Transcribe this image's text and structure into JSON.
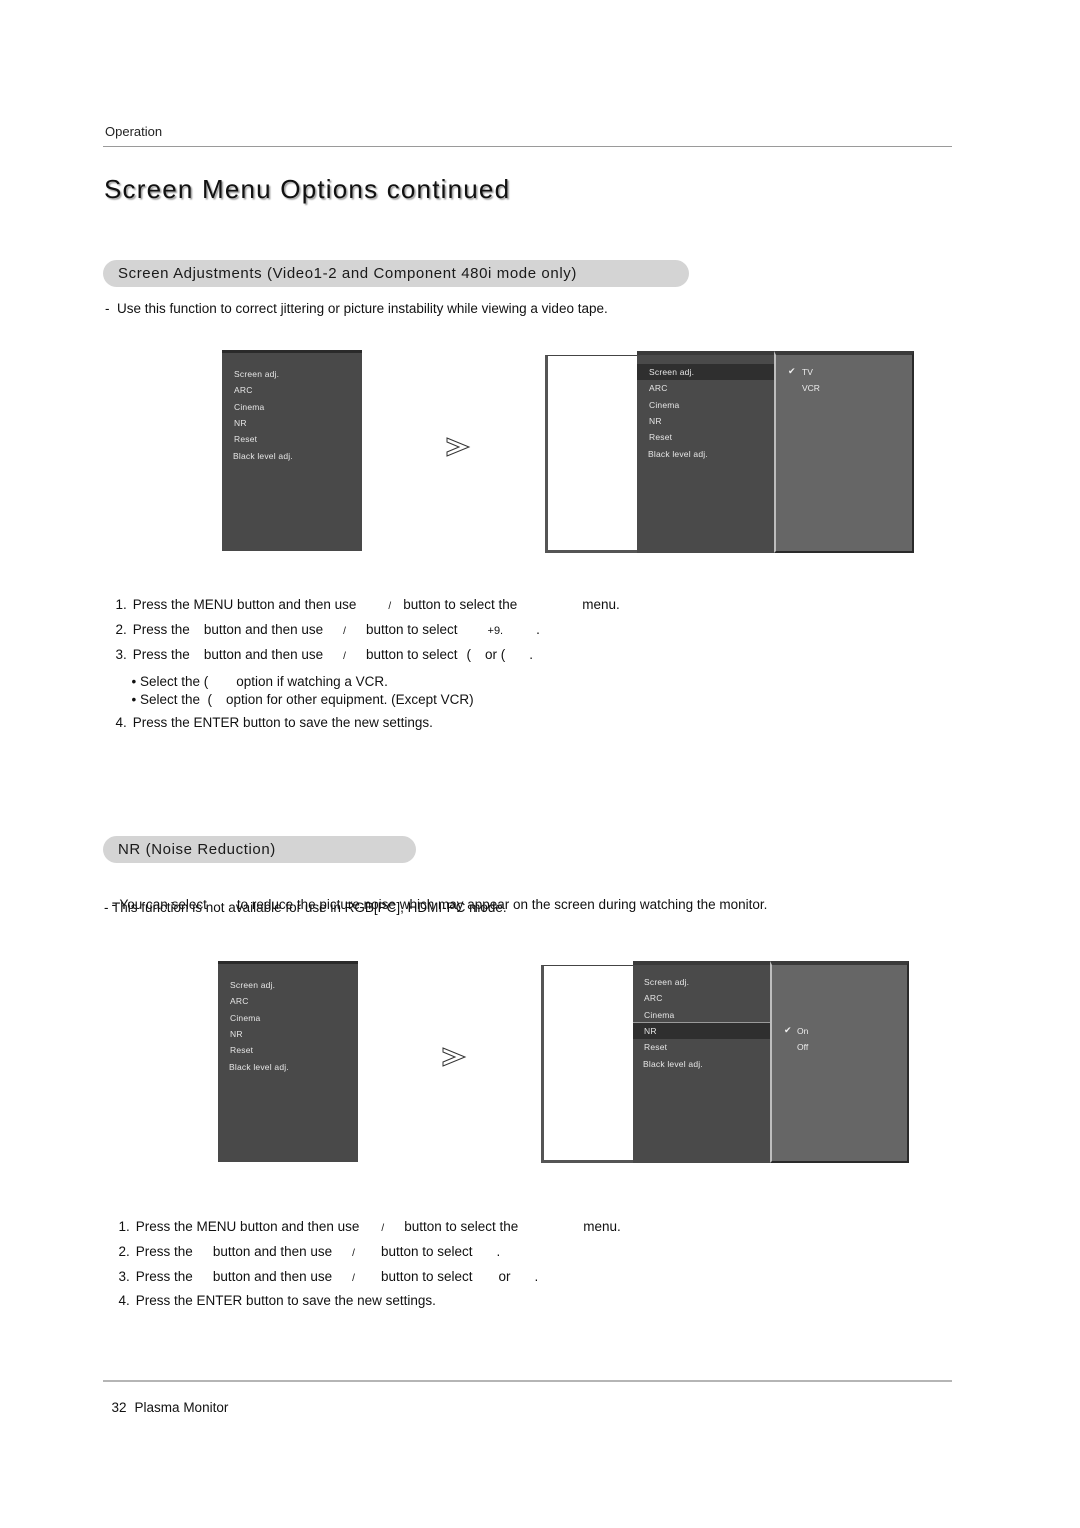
{
  "header": {
    "section": "Operation",
    "title": "Screen Menu Options continued"
  },
  "screen_adjustments": {
    "heading": "Screen Adjustments (Video1-2 and Component 480i mode only)",
    "note": "-  Use this function to correct jittering or picture instability while viewing a video tape.",
    "menu_items": [
      "Screen adj.",
      "ARC",
      "Cinema",
      "NR",
      "Reset",
      "Black level adj."
    ],
    "selected_item": "Screen adj.",
    "options": [
      {
        "label": "TV",
        "checked": true
      },
      {
        "label": "VCR",
        "checked": false
      }
    ],
    "steps": [
      {
        "num": "1.",
        "parts": [
          "Press the MENU button and then use",
          "/",
          "button to select the",
          "menu."
        ]
      },
      {
        "num": "2.",
        "parts": [
          "Press the",
          "button and then use",
          "/",
          "button to select",
          "+9.",
          "."
        ]
      },
      {
        "num": "3.",
        "parts": [
          "Press the",
          "button and then use",
          "/",
          "button to select",
          "(",
          "or (",
          "."
        ]
      },
      {
        "num": "4.",
        "parts": [
          "Press the ENTER button to save the new settings."
        ]
      }
    ],
    "bullets": [
      {
        "parts": [
          "• Select the (",
          "option if watching a VCR."
        ]
      },
      {
        "parts": [
          "• Select the  (",
          "option for other equipment. (Except VCR)"
        ]
      }
    ]
  },
  "noise_reduction": {
    "heading": "NR (Noise Reduction)",
    "notes": [
      [
        "- You can select",
        "to reduce the picture noise which may appear on the screen during watching the monitor."
      ],
      [
        "- This function is not available for use in RGB[PC], HDMI-PC mode."
      ]
    ],
    "menu_items": [
      "Screen adj.",
      "ARC",
      "Cinema",
      "NR",
      "Reset",
      "Black level adj."
    ],
    "selected_item": "NR",
    "options": [
      {
        "label": "On",
        "checked": true
      },
      {
        "label": "Off",
        "checked": false
      }
    ],
    "steps": [
      {
        "num": "1.",
        "parts": [
          "Press the MENU button and then use",
          "/",
          "button to select the",
          "menu."
        ]
      },
      {
        "num": "2.",
        "parts": [
          "Press the",
          "button and then use",
          "/",
          "button to select",
          "."
        ]
      },
      {
        "num": "3.",
        "parts": [
          "Press the",
          "button and then use",
          "/",
          "button to select",
          "or",
          "."
        ]
      },
      {
        "num": "4.",
        "parts": [
          "Press the ENTER button to save the new settings."
        ]
      }
    ]
  },
  "icons": {
    "arrow": "arrow-right-icon",
    "check": "✔"
  },
  "footer": {
    "page_number": "32",
    "product": "Plasma Monitor"
  }
}
